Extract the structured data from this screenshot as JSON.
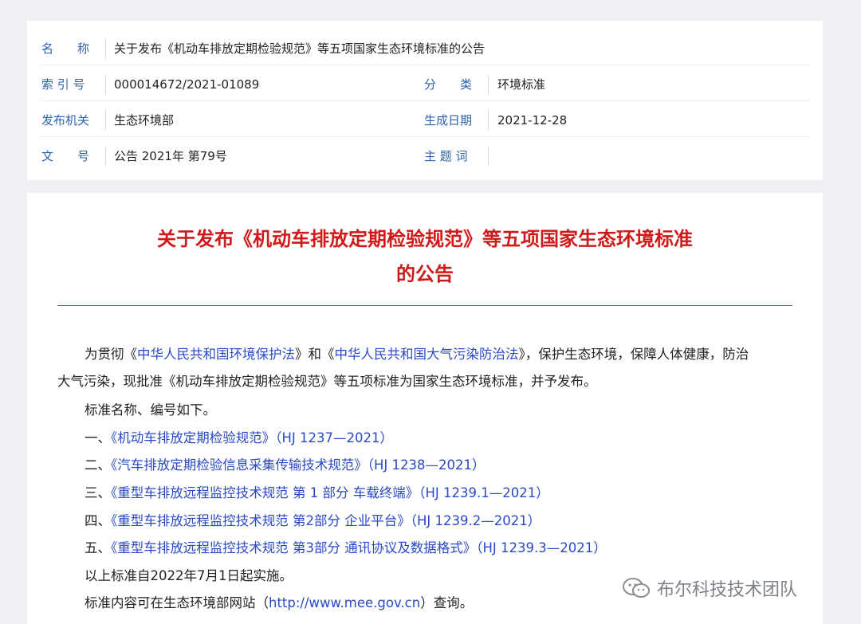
{
  "meta": {
    "name_label": "名　　称",
    "name_value": "关于发布《机动车排放定期检验规范》等五项国家生态环境标准的公告",
    "index_label": "索 引 号",
    "index_value": "000014672/2021-01089",
    "category_label": "分　　类",
    "category_value": "环境标准",
    "issuer_label": "发布机关",
    "issuer_value": "生态环境部",
    "date_label": "生成日期",
    "date_value": "2021-12-28",
    "doc_no_label": "文　　号",
    "doc_no_value": "公告 2021年 第79号",
    "keywords_label": "主 题 词",
    "keywords_value": ""
  },
  "doc": {
    "title_line1": "关于发布《机动车排放定期检验规范》等五项国家生态环境标准",
    "title_line2": "的公告",
    "intro_a": "为贯彻《",
    "law1": "中华人民共和国环境保护法",
    "intro_b": "》和《",
    "law2": "中华人民共和国大气污染防治法",
    "intro_c": "》，保护生态环境，保障人体健康，防治",
    "intro_line2": "大气污染，现批准《机动车排放定期检验规范》等五项标准为国家生态环境标准，并予发布。",
    "list_intro": "标准名称、编号如下。",
    "items": [
      {
        "num": "一、",
        "text": "《机动车排放定期检验规范》（HJ 1237—2021）"
      },
      {
        "num": "二、",
        "text": "《汽车排放定期检验信息采集传输技术规范》（HJ 1238—2021）"
      },
      {
        "num": "三、",
        "text": "《重型车排放远程监控技术规范 第 1 部分 车载终端》（HJ 1239.1—2021）"
      },
      {
        "num": "四、",
        "text": "《重型车排放远程监控技术规范 第2部分 企业平台》（HJ 1239.2—2021）"
      },
      {
        "num": "五、",
        "text": "《重型车排放远程监控技术规范 第3部分 通讯协议及数据格式》（HJ 1239.3—2021）"
      }
    ],
    "effective": "以上标准自2022年7月1日起实施。",
    "site_a": "标准内容可在生态环境部网站（",
    "site_url": "http://www.mee.gov.cn",
    "site_b": "）查询。"
  },
  "watermark": {
    "text": "布尔科技技术团队",
    "icon": "wechat-icon"
  }
}
